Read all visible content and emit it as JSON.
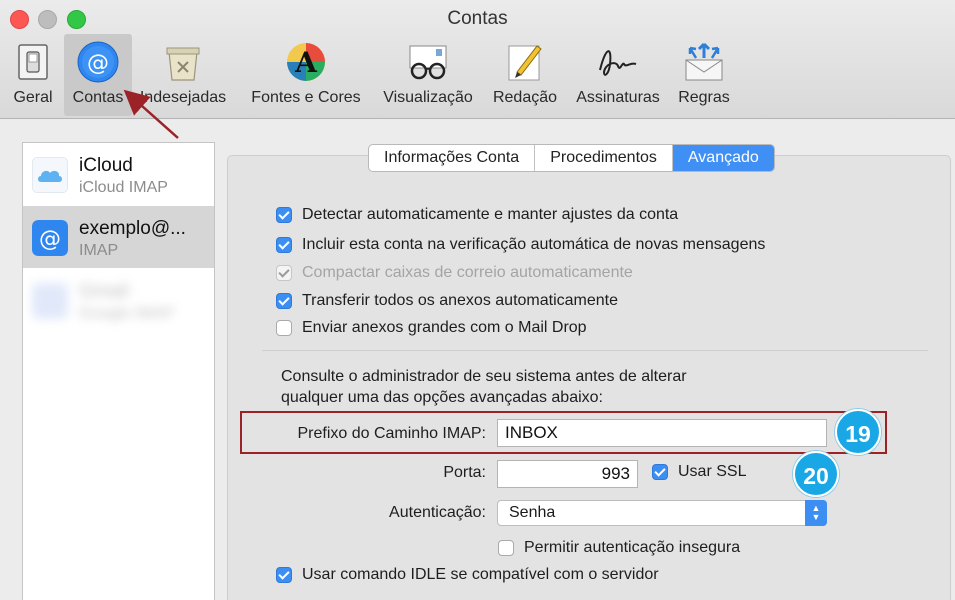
{
  "window": {
    "title": "Contas"
  },
  "toolbar": {
    "items": [
      {
        "label": "Geral",
        "icon": "switch-icon"
      },
      {
        "label": "Contas",
        "icon": "at-sign-icon",
        "active": true
      },
      {
        "label": "Indesejadas",
        "icon": "junk-bin-icon"
      },
      {
        "label": "Fontes e Cores",
        "icon": "fonts-colors-icon"
      },
      {
        "label": "Visualização",
        "icon": "glasses-icon"
      },
      {
        "label": "Redação",
        "icon": "pencil-note-icon"
      },
      {
        "label": "Assinaturas",
        "icon": "signature-icon"
      },
      {
        "label": "Regras",
        "icon": "rules-envelope-icon"
      }
    ]
  },
  "accounts": [
    {
      "name": "iCloud",
      "type": "iCloud IMAP",
      "icon": "cloud-icon"
    },
    {
      "name": "exemplo@...",
      "type": "IMAP",
      "icon": "at-sign-icon",
      "selected": true
    },
    {
      "name": "Gmail",
      "type": "Google IMAP",
      "icon": "gmail-icon"
    }
  ],
  "tabs": [
    {
      "label": "Informações Conta"
    },
    {
      "label": "Procedimentos"
    },
    {
      "label": "Avançado",
      "selected": true
    }
  ],
  "options": [
    {
      "label": "Detectar automaticamente e manter ajustes da conta",
      "checked": true
    },
    {
      "label": "Incluir esta conta na verificação automática de novas mensagens",
      "checked": true
    },
    {
      "label": "Compactar caixas de correio automaticamente",
      "checked": true,
      "disabled": true
    },
    {
      "label": "Transferir todos os anexos automaticamente",
      "checked": true
    },
    {
      "label": "Enviar anexos grandes com o Mail Drop",
      "checked": false
    }
  ],
  "advanced_note": {
    "line1": "Consulte o administrador de seu sistema antes de alterar",
    "line2": "qualquer uma das opções avançadas abaixo:"
  },
  "imap_prefix": {
    "label": "Prefixo do Caminho IMAP:",
    "value": "INBOX"
  },
  "port": {
    "label": "Porta:",
    "value": "993"
  },
  "ssl": {
    "label": "Usar SSL",
    "checked": true
  },
  "auth": {
    "label": "Autenticação:",
    "value": "Senha"
  },
  "insecure_auth": {
    "label": "Permitir autenticação insegura",
    "checked": false
  },
  "idle": {
    "label": "Usar comando IDLE se compatível com o servidor",
    "checked": true
  },
  "annotations": {
    "badge_19": "19",
    "badge_20": "20"
  },
  "colors": {
    "accent": "#3c8ef3",
    "highlight": "#9b2226",
    "badge": "#1aa7e6"
  }
}
